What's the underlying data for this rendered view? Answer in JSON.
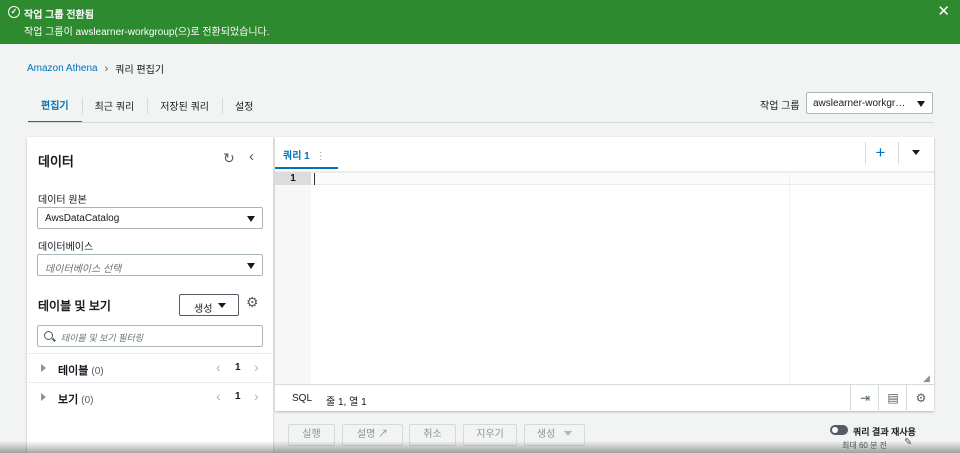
{
  "flash": {
    "title": "작업 그룹 전환됨",
    "message": "작업 그룹이 awslearner-workgroup(으)로 전환되었습니다.",
    "close": "✕",
    "icon": "check-circle-icon"
  },
  "breadcrumb": {
    "root": "Amazon Athena",
    "separator": "›",
    "current": "쿼리 편집기"
  },
  "tabs": [
    {
      "label": "편집기",
      "active": true
    },
    {
      "label": "최근 쿼리",
      "active": false
    },
    {
      "label": "저장된 쿼리",
      "active": false
    },
    {
      "label": "설정",
      "active": false
    }
  ],
  "workgroup": {
    "label": "작업 그룹",
    "value": "awslearner-workgr…"
  },
  "data_panel": {
    "title": "데이터",
    "datasource_label": "데이터 원본",
    "datasource_value": "AwsDataCatalog",
    "database_label": "데이터베이스",
    "database_placeholder": "데이터베이스 선택",
    "tables_views_title": "테이블 및 보기",
    "create_label": "생성",
    "filter_placeholder": "테이블 및 보기 필터링",
    "tables": {
      "label": "테이블",
      "count": "(0)",
      "page": "1"
    },
    "views": {
      "label": "보기",
      "count": "(0)",
      "page": "1"
    }
  },
  "editor": {
    "tab_label": "쿼리 1",
    "tab_menu": "⋮",
    "add": "+",
    "line_number": "1",
    "language": "SQL",
    "position": "줄 1, 열 1"
  },
  "actions": {
    "run": "실행",
    "explain": "설명",
    "cancel": "취소",
    "clear": "지우기",
    "create": "생성"
  },
  "reuse": {
    "label": "쿼리 결과 재사용",
    "sub": "최대 60 분 전"
  },
  "colors": {
    "flash_bg": "#2e8a2e",
    "accent": "#0073bb",
    "page_bg": "#f2f3f3"
  }
}
